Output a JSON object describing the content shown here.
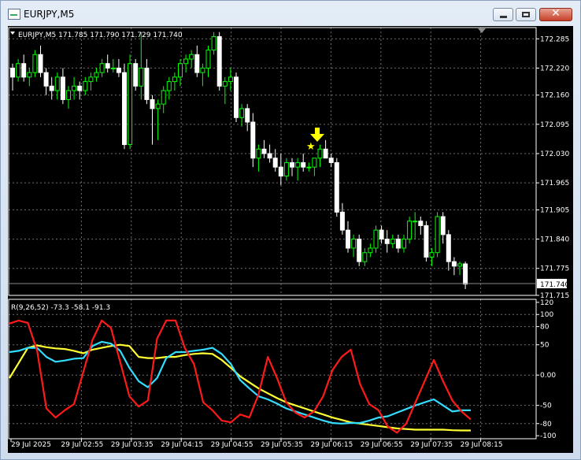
{
  "window": {
    "title": "EURJPY,M5"
  },
  "chart_info": {
    "header": "EURJPY,M5  171.785 171.790 171.729 171.740"
  },
  "price_axis": {
    "ticks": [
      "172.285",
      "172.220",
      "172.160",
      "172.095",
      "172.030",
      "171.965",
      "171.905",
      "171.840",
      "171.775",
      "171.715"
    ],
    "current_price": "171.740"
  },
  "indicator": {
    "header": "R(9,26,52) -73.3 -58.1 -91.3",
    "ticks": [
      "120",
      "100",
      "80",
      "50",
      "0.00",
      "-50",
      "-80",
      "-100"
    ]
  },
  "time_axis": {
    "labels": [
      "29 Jul 2025",
      "29 Jul 02:55",
      "29 Jul 03:35",
      "29 Jul 04:15",
      "29 Jul 04:55",
      "29 Jul 05:35",
      "29 Jul 06:15",
      "29 Jul 06:55",
      "29 Jul 07:35",
      "29 Jul 08:15"
    ]
  },
  "colors": {
    "background": "#000000",
    "grid": "#6f6f6f",
    "bull": "#00ff00",
    "bear": "#ffffff",
    "signal": "#ffff00",
    "line_red": "#ff1a1a",
    "line_cyan": "#33ddff",
    "line_yellow": "#ffff33"
  },
  "signal": {
    "icons": [
      "down-arrow-icon",
      "star-icon"
    ]
  },
  "chart_data": [
    {
      "type": "candlestick",
      "symbol": "EURJPY",
      "timeframe": "M5",
      "ohlc_last": {
        "open": 171.785,
        "high": 171.79,
        "low": 171.729,
        "close": 171.74
      },
      "ylim": [
        171.715,
        172.31
      ],
      "candles": [
        [
          172.22,
          172.23,
          172.17,
          172.2
        ],
        [
          172.2,
          172.24,
          172.19,
          172.23
        ],
        [
          172.23,
          172.25,
          172.19,
          172.2
        ],
        [
          172.2,
          172.22,
          172.18,
          172.21
        ],
        [
          172.21,
          172.26,
          172.2,
          172.25
        ],
        [
          172.25,
          172.27,
          172.2,
          172.21
        ],
        [
          172.21,
          172.22,
          172.16,
          172.18
        ],
        [
          172.18,
          172.2,
          172.15,
          172.17
        ],
        [
          172.17,
          172.21,
          172.15,
          172.2
        ],
        [
          172.2,
          172.22,
          172.14,
          172.15
        ],
        [
          172.15,
          172.18,
          172.13,
          172.17
        ],
        [
          172.17,
          172.2,
          172.15,
          172.18
        ],
        [
          172.18,
          172.19,
          172.15,
          172.17
        ],
        [
          172.17,
          172.2,
          172.16,
          172.19
        ],
        [
          172.19,
          172.21,
          172.17,
          172.2
        ],
        [
          172.2,
          172.22,
          172.19,
          172.21
        ],
        [
          172.21,
          172.24,
          172.2,
          172.23
        ],
        [
          172.23,
          172.25,
          172.21,
          172.22
        ],
        [
          172.22,
          172.24,
          172.21,
          172.22
        ],
        [
          172.22,
          172.24,
          172.2,
          172.21
        ],
        [
          172.21,
          172.23,
          172.04,
          172.05
        ],
        [
          172.05,
          172.25,
          172.04,
          172.23
        ],
        [
          172.23,
          172.24,
          172.17,
          172.18
        ],
        [
          172.18,
          172.3,
          172.15,
          172.22
        ],
        [
          172.22,
          172.24,
          172.14,
          172.15
        ],
        [
          172.15,
          172.16,
          172.05,
          172.13
        ],
        [
          172.13,
          172.15,
          172.06,
          172.14
        ],
        [
          172.14,
          172.18,
          172.12,
          172.17
        ],
        [
          172.17,
          172.2,
          172.15,
          172.19
        ],
        [
          172.19,
          172.21,
          172.17,
          172.2
        ],
        [
          172.2,
          172.24,
          172.18,
          172.23
        ],
        [
          172.23,
          172.25,
          172.21,
          172.24
        ],
        [
          172.24,
          172.26,
          172.22,
          172.25
        ],
        [
          172.25,
          172.27,
          172.2,
          172.21
        ],
        [
          172.21,
          172.23,
          172.18,
          172.22
        ],
        [
          172.22,
          172.27,
          172.2,
          172.26
        ],
        [
          172.26,
          172.3,
          172.25,
          172.29
        ],
        [
          172.29,
          172.3,
          172.17,
          172.18
        ],
        [
          172.18,
          172.2,
          172.14,
          172.19
        ],
        [
          172.19,
          172.22,
          172.17,
          172.2
        ],
        [
          172.2,
          172.21,
          172.1,
          172.11
        ],
        [
          172.11,
          172.14,
          172.09,
          172.13
        ],
        [
          172.13,
          172.14,
          172.08,
          172.1
        ],
        [
          172.1,
          172.12,
          172.0,
          172.02
        ],
        [
          172.02,
          172.05,
          171.99,
          172.04
        ],
        [
          172.04,
          172.06,
          172.02,
          172.03
        ],
        [
          172.03,
          172.05,
          172.01,
          172.02
        ],
        [
          172.02,
          172.04,
          171.99,
          172.0
        ],
        [
          172.0,
          172.03,
          171.96,
          171.98
        ],
        [
          171.98,
          172.02,
          171.97,
          172.01
        ],
        [
          172.01,
          172.02,
          171.98,
          172.0
        ],
        [
          172.0,
          172.02,
          171.97,
          172.01
        ],
        [
          172.01,
          172.03,
          171.99,
          172.0
        ],
        [
          172.0,
          172.01,
          171.99,
          172.0
        ],
        [
          172.0,
          172.02,
          171.98,
          172.02
        ],
        [
          172.02,
          172.05,
          172.0,
          172.04
        ],
        [
          172.04,
          172.06,
          172.02,
          172.02
        ],
        [
          172.02,
          172.03,
          172.0,
          172.01
        ],
        [
          172.01,
          172.02,
          171.89,
          171.9
        ],
        [
          171.9,
          171.92,
          171.85,
          171.86
        ],
        [
          171.86,
          171.88,
          171.81,
          171.82
        ],
        [
          171.82,
          171.85,
          171.8,
          171.84
        ],
        [
          171.84,
          171.85,
          171.78,
          171.79
        ],
        [
          171.79,
          171.82,
          171.78,
          171.81
        ],
        [
          171.81,
          171.83,
          171.8,
          171.82
        ],
        [
          171.82,
          171.87,
          171.81,
          171.86
        ],
        [
          171.86,
          171.87,
          171.83,
          171.84
        ],
        [
          171.84,
          171.86,
          171.81,
          171.83
        ],
        [
          171.83,
          171.85,
          171.82,
          171.84
        ],
        [
          171.84,
          171.85,
          171.81,
          171.82
        ],
        [
          171.82,
          171.85,
          171.81,
          171.84
        ],
        [
          171.84,
          171.89,
          171.83,
          171.88
        ],
        [
          171.88,
          171.9,
          171.84,
          171.88
        ],
        [
          171.88,
          171.89,
          171.85,
          171.87
        ],
        [
          171.87,
          171.88,
          171.79,
          171.8
        ],
        [
          171.8,
          171.82,
          171.78,
          171.81
        ],
        [
          171.81,
          171.9,
          171.8,
          171.89
        ],
        [
          171.89,
          171.9,
          171.83,
          171.85
        ],
        [
          171.85,
          171.86,
          171.77,
          171.79
        ],
        [
          171.79,
          171.8,
          171.76,
          171.78
        ],
        [
          171.78,
          171.79,
          171.76,
          171.785
        ],
        [
          171.785,
          171.79,
          171.729,
          171.74
        ]
      ]
    },
    {
      "type": "line",
      "title": "R(9,26,52)",
      "ylim": [
        -105,
        125
      ],
      "last_values": [
        -73.3,
        -58.1,
        -91.3
      ],
      "series": [
        {
          "name": "9",
          "values": [
            85,
            90,
            86,
            40,
            -55,
            -70,
            -58,
            -48,
            5,
            58,
            90,
            78,
            22,
            -35,
            -52,
            -42,
            60,
            90,
            90,
            45,
            18,
            -45,
            -58,
            -75,
            -78,
            -65,
            -70,
            -32,
            30,
            -5,
            -45,
            -62,
            -70,
            -60,
            -35,
            8,
            30,
            42,
            -15,
            -48,
            -58,
            -85,
            -95,
            -80,
            -45,
            -10,
            25,
            -10,
            -42,
            -60,
            -73.3
          ]
        },
        {
          "name": "26",
          "values": [
            38,
            40,
            45,
            45,
            30,
            22,
            24,
            27,
            28,
            48,
            55,
            52,
            40,
            12,
            -10,
            -20,
            -5,
            28,
            38,
            38,
            40,
            42,
            45,
            35,
            18,
            -8,
            -22,
            -35,
            -40,
            -47,
            -55,
            -60,
            -65,
            -70,
            -75,
            -79,
            -80,
            -79,
            -79,
            -75,
            -70,
            -68,
            -62,
            -56,
            -50,
            -45,
            -40,
            -50,
            -60,
            -58.1,
            -58.1
          ]
        },
        {
          "name": "52",
          "values": [
            -5,
            20,
            45,
            49,
            46,
            44,
            43,
            40,
            36,
            42,
            45,
            48,
            50,
            48,
            30,
            28,
            28,
            30,
            30,
            33,
            35,
            36,
            35,
            25,
            12,
            -2,
            -12,
            -22,
            -30,
            -38,
            -45,
            -50,
            -55,
            -60,
            -65,
            -70,
            -74,
            -78,
            -80,
            -82,
            -84,
            -86,
            -88,
            -89,
            -90,
            -90,
            -90,
            -90,
            -91,
            -91.3,
            -91.3
          ]
        }
      ]
    }
  ]
}
